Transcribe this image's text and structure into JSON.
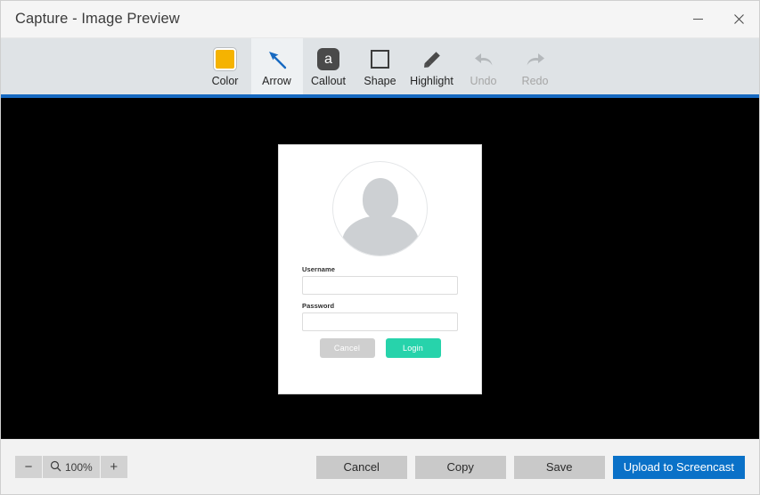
{
  "window": {
    "title": "Capture - Image Preview",
    "controls": [
      {
        "name": "minimize",
        "icon": "minimize-icon"
      },
      {
        "name": "close",
        "icon": "close-icon"
      }
    ]
  },
  "toolbar": {
    "accent_color": "#1669c1",
    "background": "#dfe3e6",
    "tools": [
      {
        "id": "color",
        "label": "Color",
        "icon": "color-swatch-icon",
        "swatch_color": "#f5b301",
        "state": "enabled"
      },
      {
        "id": "arrow",
        "label": "Arrow",
        "icon": "arrow-icon",
        "state": "selected"
      },
      {
        "id": "callout",
        "label": "Callout",
        "icon": "callout-icon",
        "badge_text": "a",
        "state": "enabled"
      },
      {
        "id": "shape",
        "label": "Shape",
        "icon": "square-shape-icon",
        "state": "enabled"
      },
      {
        "id": "highlight",
        "label": "Highlight",
        "icon": "highlighter-icon",
        "state": "enabled"
      },
      {
        "id": "undo",
        "label": "Undo",
        "icon": "undo-arrow-icon",
        "state": "disabled"
      },
      {
        "id": "redo",
        "label": "Redo",
        "icon": "redo-arrow-icon",
        "state": "disabled"
      }
    ]
  },
  "canvas": {
    "background": "#000000",
    "image": {
      "kind": "login-form-screenshot",
      "avatar_icon": "user-avatar-icon",
      "fields": [
        {
          "label": "Username",
          "value": "",
          "placeholder": ""
        },
        {
          "label": "Password",
          "value": "",
          "placeholder": ""
        }
      ],
      "buttons": [
        {
          "label": "Cancel",
          "color": "#cfcfcf"
        },
        {
          "label": "Login",
          "color": "#27d3ab"
        }
      ]
    }
  },
  "bottombar": {
    "zoom": {
      "decrease_label": "−",
      "icon": "magnifier-icon",
      "level": "100%",
      "increase_label": "+"
    },
    "actions": [
      {
        "id": "cancel",
        "label": "Cancel",
        "style": "secondary"
      },
      {
        "id": "copy",
        "label": "Copy",
        "style": "secondary"
      },
      {
        "id": "save",
        "label": "Save",
        "style": "secondary"
      },
      {
        "id": "upload",
        "label": "Upload to Screencast",
        "style": "primary",
        "color": "#0a71c8"
      }
    ]
  }
}
